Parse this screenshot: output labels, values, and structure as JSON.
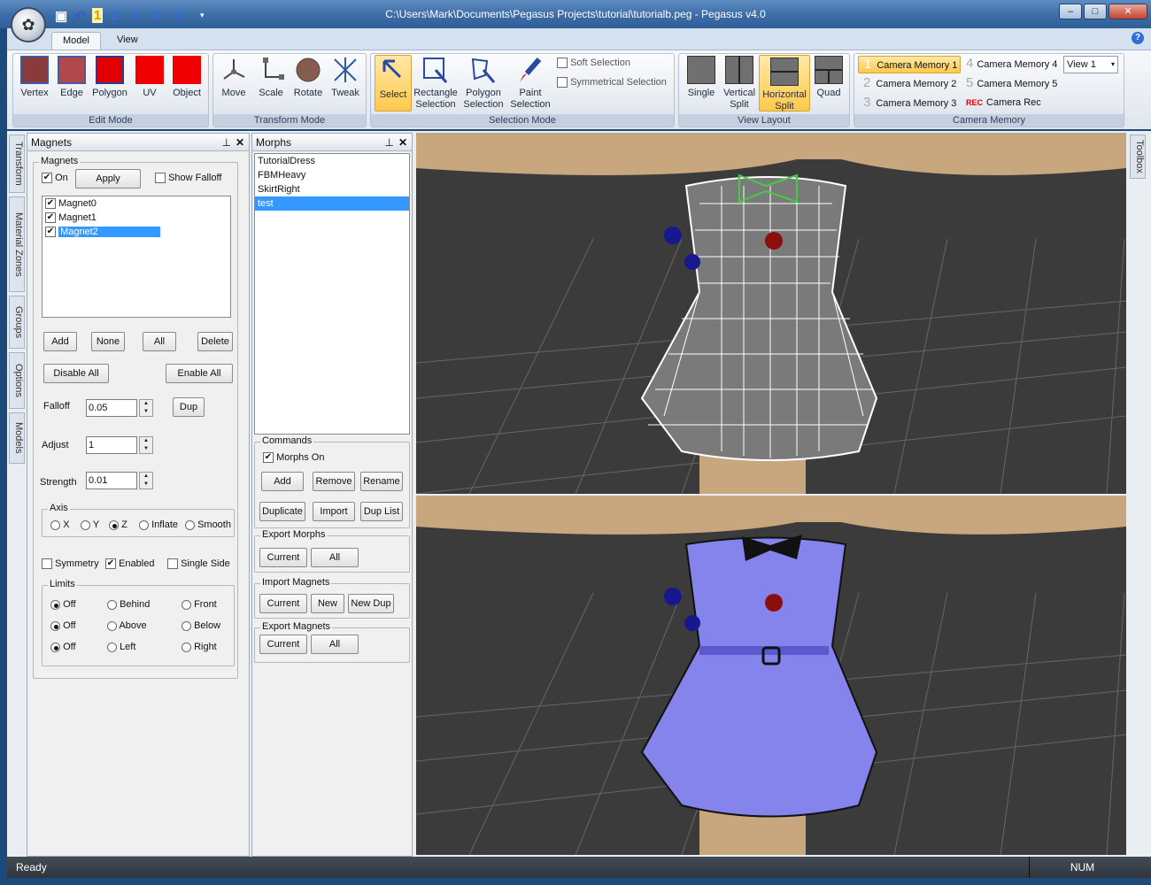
{
  "window": {
    "title": "C:\\Users\\Mark\\Documents\\Pegasus Projects\\tutorial\\tutorialb.peg - Pegasus v4.0",
    "quick_access": [
      "1",
      "2",
      "3",
      "4",
      "5"
    ],
    "controls": {
      "minimize": "–",
      "maximize": "□",
      "close": "✕"
    }
  },
  "ribbon": {
    "tabs": [
      "Model",
      "View"
    ],
    "help": "?",
    "edit_mode": {
      "caption": "Edit Mode",
      "buttons": [
        "Vertex",
        "Edge",
        "Polygon",
        "UV",
        "Object"
      ]
    },
    "transform_mode": {
      "caption": "Transform Mode",
      "buttons": [
        "Move",
        "Scale",
        "Rotate",
        "Tweak"
      ]
    },
    "selection_mode": {
      "caption": "Selection Mode",
      "buttons": [
        {
          "line1": "Select",
          "line2": ""
        },
        {
          "line1": "Rectangle",
          "line2": "Selection"
        },
        {
          "line1": "Polygon",
          "line2": "Selection"
        },
        {
          "line1": "Paint",
          "line2": "Selection"
        }
      ],
      "options": [
        "Soft Selection",
        "Symmetrical Selection"
      ]
    },
    "view_layout": {
      "caption": "View Layout",
      "buttons": [
        {
          "line1": "Single",
          "line2": ""
        },
        {
          "line1": "Vertical",
          "line2": "Split"
        },
        {
          "line1": "Horizontal",
          "line2": "Split"
        },
        {
          "line1": "Quad",
          "line2": ""
        }
      ]
    },
    "camera_memory": {
      "caption": "Camera Memory",
      "items": [
        {
          "num": "1",
          "label": "Camera Memory 1"
        },
        {
          "num": "2",
          "label": "Camera Memory 2"
        },
        {
          "num": "3",
          "label": "Camera Memory 3"
        },
        {
          "num": "4",
          "label": "Camera Memory 4"
        },
        {
          "num": "5",
          "label": "Camera Memory 5"
        },
        {
          "num": "REC",
          "label": "Camera Rec"
        }
      ],
      "view_select": "View 1"
    }
  },
  "side_tabs": [
    "Transform",
    "Material Zones",
    "Groups",
    "Options",
    "Models"
  ],
  "right_tab": "Toolbox",
  "magnets_panel": {
    "title": "Magnets",
    "group": "Magnets",
    "on_label": "On",
    "apply": "Apply",
    "show_falloff": "Show Falloff",
    "list": [
      "Magnet0",
      "Magnet1",
      "Magnet2"
    ],
    "buttons": {
      "add": "Add",
      "none": "None",
      "all": "All",
      "delete": "Delete",
      "disable_all": "Disable All",
      "enable_all": "Enable All",
      "dup": "Dup"
    },
    "falloff_label": "Falloff",
    "falloff": "0.05",
    "adjust_label": "Adjust",
    "adjust": "1",
    "strength_label": "Strength",
    "strength": "0.01",
    "axis": {
      "label": "Axis",
      "options": [
        "X",
        "Y",
        "Z",
        "Inflate",
        "Smooth"
      ],
      "selected": "Z"
    },
    "symmetry": "Symmetry",
    "enabled": "Enabled",
    "single_side": "Single Side",
    "limits": {
      "label": "Limits",
      "rows": [
        [
          "Off",
          "Behind",
          "Front"
        ],
        [
          "Off",
          "Above",
          "Below"
        ],
        [
          "Off",
          "Left",
          "Right"
        ]
      ]
    }
  },
  "morphs_panel": {
    "title": "Morphs",
    "list": [
      "TutorialDress",
      "FBMHeavy",
      "SkirtRight",
      "test"
    ],
    "commands": {
      "label": "Commands",
      "morphs_on": "Morphs On",
      "add": "Add",
      "remove": "Remove",
      "rename": "Rename",
      "duplicate": "Duplicate",
      "import": "Import",
      "dup_list": "Dup List"
    },
    "export_morphs": {
      "label": "Export Morphs",
      "current": "Current",
      "all": "All"
    },
    "import_magnets": {
      "label": "Import Magnets",
      "current": "Current",
      "new": "New",
      "new_dup": "New Dup"
    },
    "export_magnets": {
      "label": "Export Magnets",
      "current": "Current",
      "all": "All"
    }
  },
  "status": {
    "text": "Ready",
    "num": "NUM"
  },
  "colors": {
    "accent": "#ffc94d",
    "selection": "#3399ff",
    "dress_top": "#8888ee",
    "skin": "#c8a77e"
  }
}
